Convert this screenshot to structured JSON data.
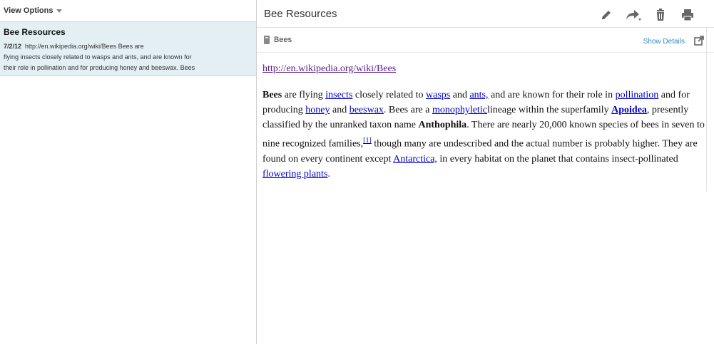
{
  "sidebar": {
    "view_options": "View Options",
    "note": {
      "title": "Bee Resources",
      "date": "7/2/12",
      "snippet_line1": "http://en.wikipedia.org/wiki/Bees Bees are",
      "snippet_line2": "flying insects closely related to wasps and ants, and are known for",
      "snippet_line3": "their role in pollination and for producing honey and beeswax. Bees"
    }
  },
  "header": {
    "title": "Bee Resources",
    "tools": [
      "pencil-icon",
      "share-icon",
      "trash-icon",
      "print-icon"
    ]
  },
  "subbar": {
    "notebook": "Bees",
    "show_details": "Show Details"
  },
  "content": {
    "url": "http://en.wikipedia.org/wiki/Bees",
    "p": {
      "bees": "Bees",
      "t1": " are flying ",
      "insects": "insects",
      "t2": " closely related to ",
      "wasps": "wasps",
      "t3": " and ",
      "ants": "ants,",
      "t4": " and are known for their role in ",
      "pollination": "pollination",
      "t5": " and for producing ",
      "honey": "honey",
      "t6": " and ",
      "beeswax": "beeswax",
      "t7": ". Bees are a ",
      "monophyletic": "monophyletic",
      "t8": "lineage within the superfamily ",
      "apoidea": "Apoidea",
      "t9": ", presently classified by the unranked taxon name ",
      "anthophila": "Anthophila",
      "t10": ". There are nearly 20,000 known species of bees in seven to nine recognized families,",
      "ref1": "[1]",
      "t11": " though many are undescribed and the actual number is probably higher. They are found on every continent except ",
      "antarctica": "Antarctica,",
      "t12": " in every habitat on the planet that contains insect-pollinated ",
      "flowering": "flowering plants",
      "t13": "."
    }
  },
  "colors": {
    "accent_link": "#2d8ac6",
    "selected_note_bg": "#e3eff3"
  }
}
